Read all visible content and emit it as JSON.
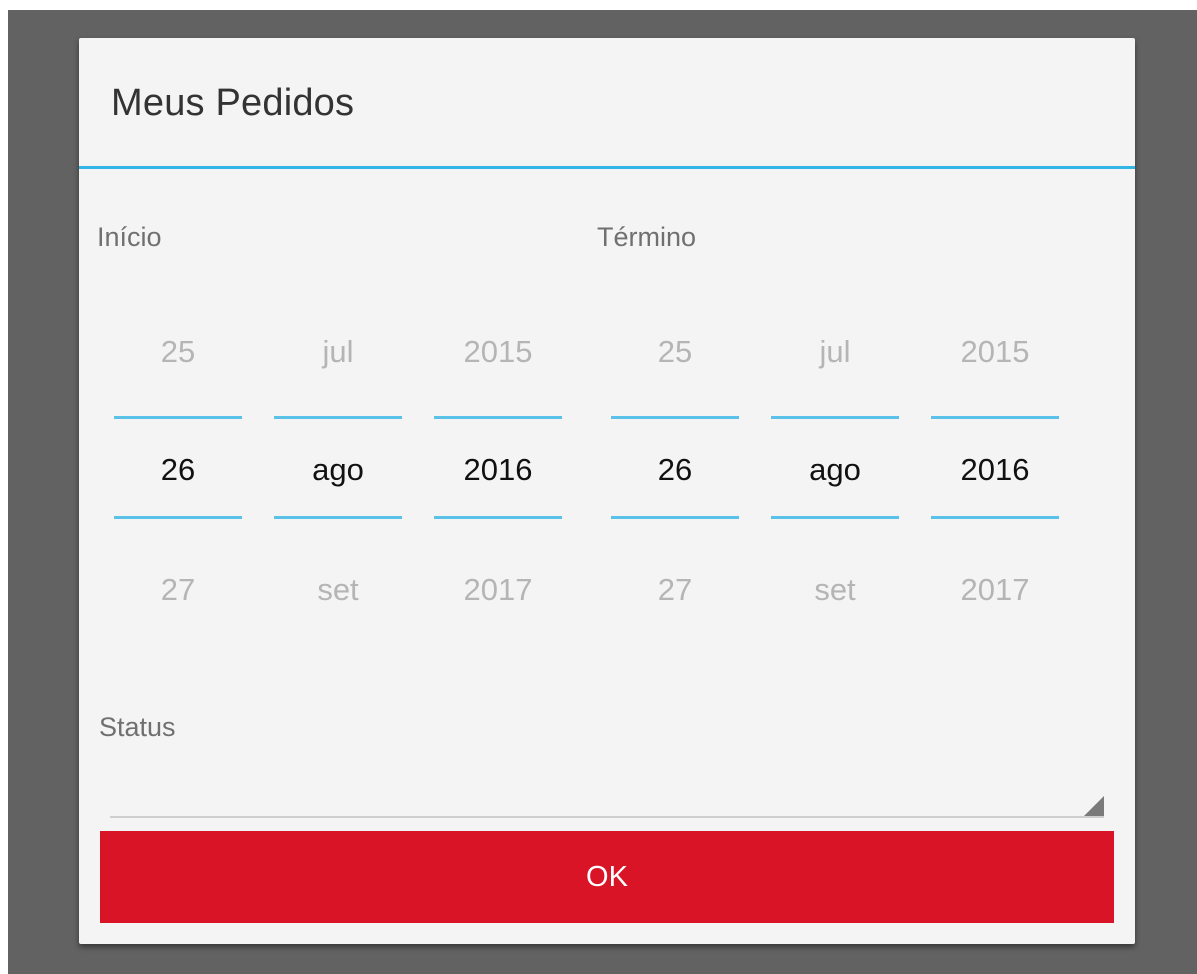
{
  "dialog": {
    "title": "Meus Pedidos"
  },
  "start": {
    "label": "Início",
    "day": {
      "prev": "25",
      "current": "26",
      "next": "27"
    },
    "month": {
      "prev": "jul",
      "current": "ago",
      "next": "set"
    },
    "year": {
      "prev": "2015",
      "current": "2016",
      "next": "2017"
    }
  },
  "end": {
    "label": "Término",
    "day": {
      "prev": "25",
      "current": "26",
      "next": "27"
    },
    "month": {
      "prev": "jul",
      "current": "ago",
      "next": "set"
    },
    "year": {
      "prev": "2015",
      "current": "2016",
      "next": "2017"
    }
  },
  "status": {
    "label": "Status",
    "selected_value": ""
  },
  "actions": {
    "ok_label": "OK"
  },
  "colors": {
    "accent": "#33b5e5",
    "button": "#d91427",
    "scrim": "#626262",
    "dialog_bg": "#f4f4f4"
  }
}
